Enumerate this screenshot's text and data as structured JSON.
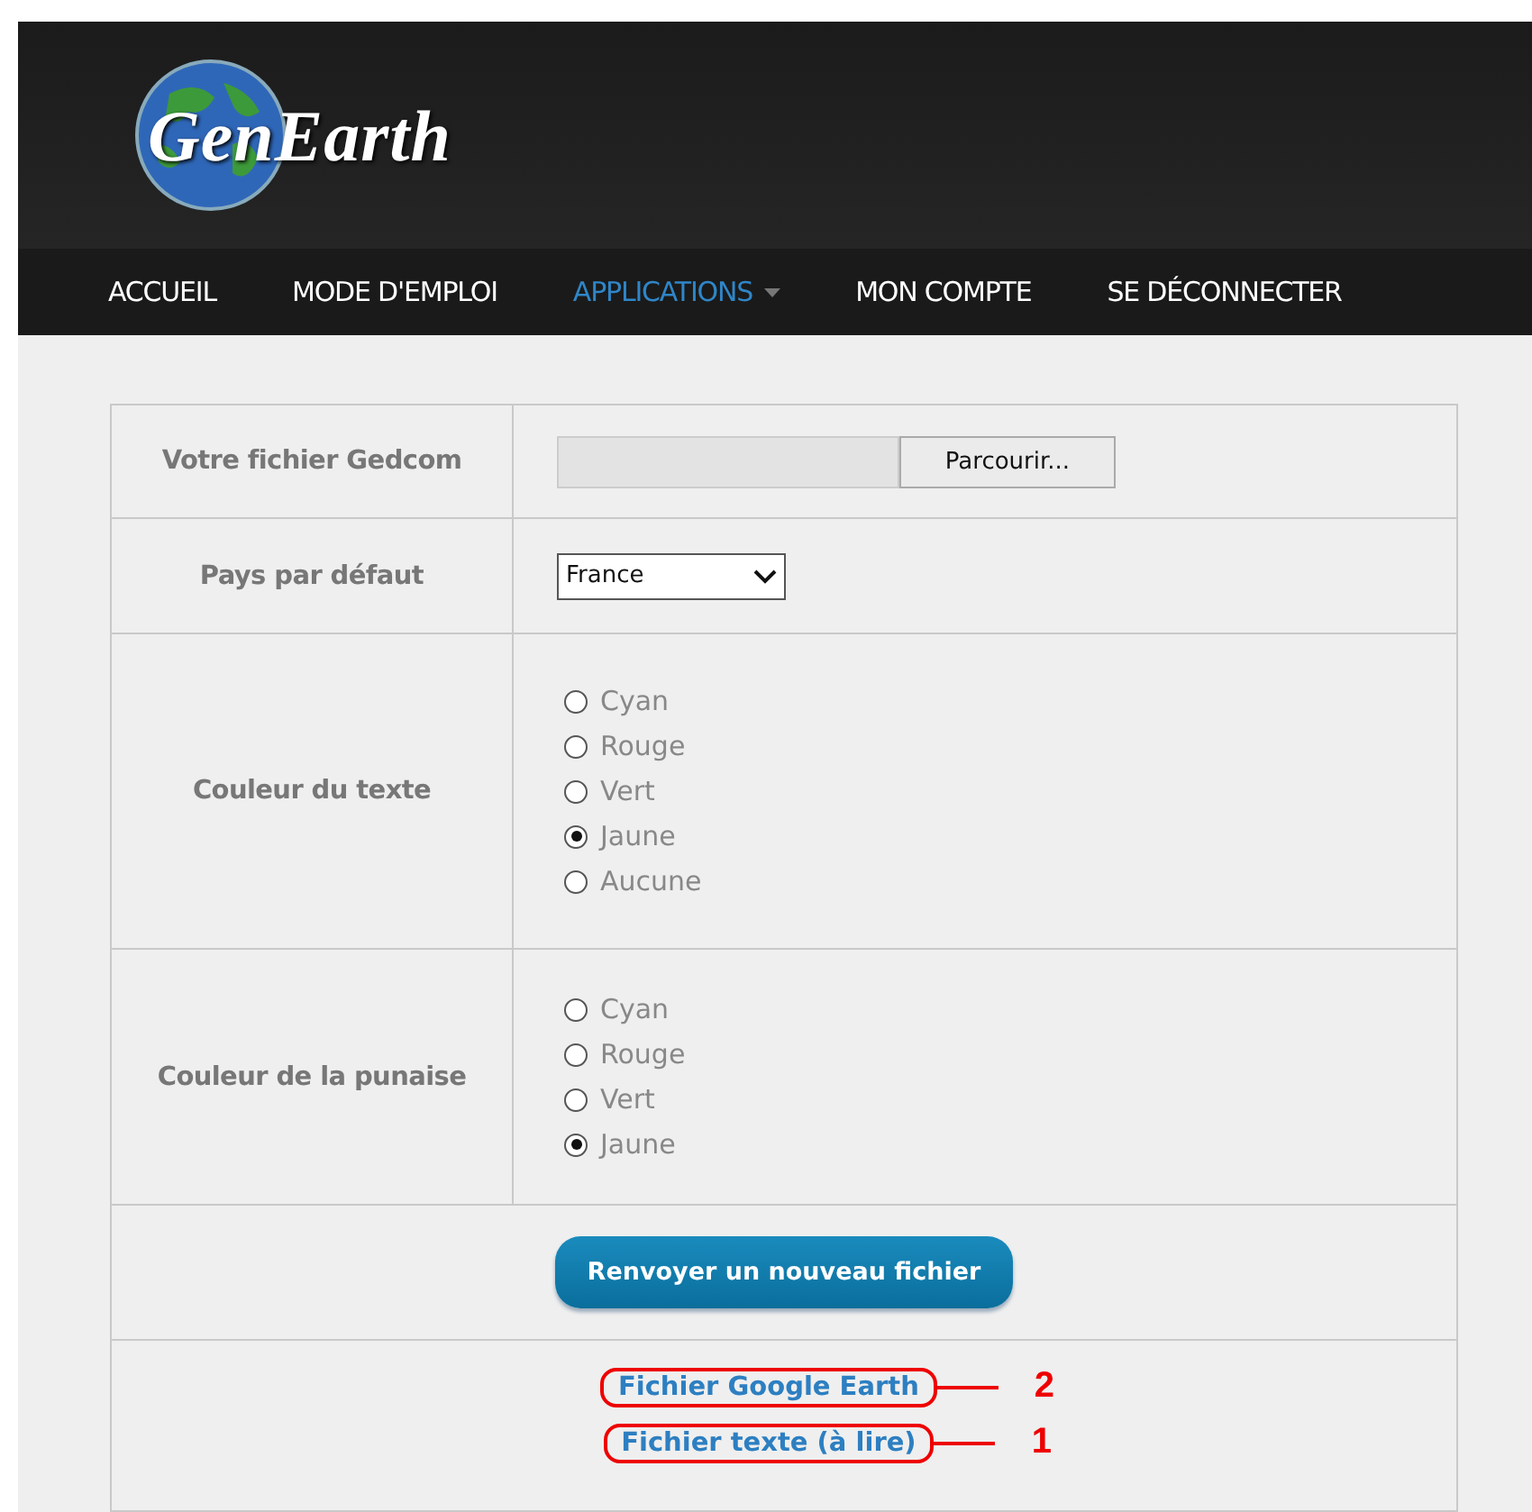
{
  "logo": {
    "text": "GenEarth"
  },
  "nav": [
    {
      "label": "ACCUEIL",
      "selected": false,
      "has_menu": false
    },
    {
      "label": "MODE D'EMPLOI",
      "selected": false,
      "has_menu": false
    },
    {
      "label": "APPLICATIONS",
      "selected": true,
      "has_menu": true
    },
    {
      "label": "MON COMPTE",
      "selected": false,
      "has_menu": false
    },
    {
      "label": "SE DÉCONNECTER",
      "selected": false,
      "has_menu": false
    }
  ],
  "form": {
    "file": {
      "label": "Votre fichier Gedcom",
      "button": "Parcourir..."
    },
    "country": {
      "label": "Pays par défaut",
      "value": "France"
    },
    "radio_groups": [
      {
        "label": "Couleur du texte",
        "options": [
          {
            "label": "Cyan",
            "selected": false
          },
          {
            "label": "Rouge",
            "selected": false
          },
          {
            "label": "Vert",
            "selected": false
          },
          {
            "label": "Jaune",
            "selected": true
          },
          {
            "label": "Aucune",
            "selected": false
          }
        ]
      },
      {
        "label": "Couleur de la punaise",
        "options": [
          {
            "label": "Cyan",
            "selected": false
          },
          {
            "label": "Rouge",
            "selected": false
          },
          {
            "label": "Vert",
            "selected": false
          },
          {
            "label": "Jaune",
            "selected": true
          }
        ]
      }
    ],
    "submit": "Renvoyer un nouveau fichier",
    "links": [
      {
        "label": "Fichier Google Earth",
        "annotation": "2"
      },
      {
        "label": "Fichier texte (à lire)",
        "annotation": "1"
      }
    ]
  }
}
